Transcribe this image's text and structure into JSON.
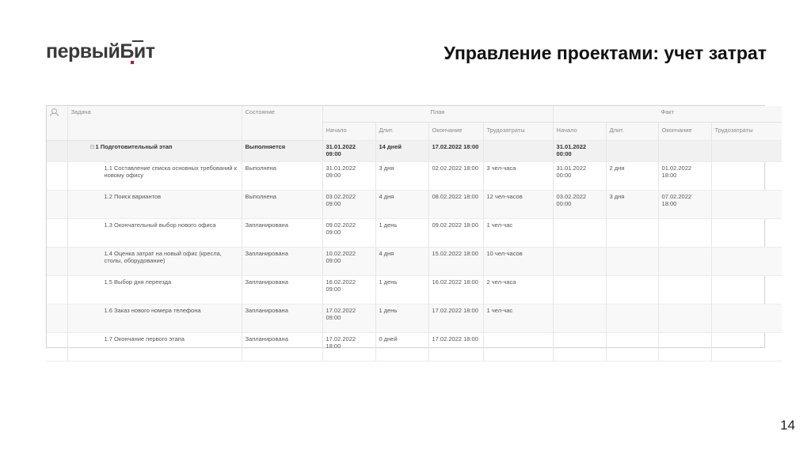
{
  "brand": {
    "logo_text": "первыйБит"
  },
  "slide": {
    "title": "Управление проектами: учет затрат",
    "page_number": "14"
  },
  "table": {
    "headers": {
      "task": "Задача",
      "status": "Состояние",
      "plan": "План",
      "fact": "Факт",
      "start": "Начало",
      "duration": "Длит.",
      "end": "Окончание",
      "effort": "Трудозатраты"
    },
    "group": {
      "task": "1  Подготовительный этап",
      "status": "Выполняется",
      "plan_start": "31.01.2022 09:00",
      "plan_duration": "14 дней",
      "plan_end": "17.02.2022 18:00",
      "plan_effort": "",
      "fact_start": "31.01.2022 00:00",
      "fact_duration": "",
      "fact_end": "",
      "fact_effort": ""
    },
    "rows": [
      {
        "task": "1.1  Составление списка основных требований к новому офису",
        "status": "Выполнена",
        "plan_start": "31.01.2022 09:00",
        "plan_duration": "3 дня",
        "plan_end": "02.02.2022 18:00",
        "plan_effort": "3 чел-часа",
        "fact_start": "31.01.2022 00:00",
        "fact_duration": "2 дня",
        "fact_end": "01.02.2022 18:00",
        "fact_effort": ""
      },
      {
        "task": "1.2  Поиск вариантов",
        "status": "Выполнена",
        "plan_start": "03.02.2022 09:00",
        "plan_duration": "4 дня",
        "plan_end": "08.02.2022 18:00",
        "plan_effort": "12 чел-часов",
        "fact_start": "03.02.2022 00:00",
        "fact_duration": "3 дня",
        "fact_end": "07.02.2022 18:00",
        "fact_effort": ""
      },
      {
        "task": "1.3  Окончательный выбор нового офиса",
        "status": "Запланирована",
        "plan_start": "09.02.2022 09:00",
        "plan_duration": "1 день",
        "plan_end": "09.02.2022 18:00",
        "plan_effort": "1 чел-час",
        "fact_start": "",
        "fact_duration": "",
        "fact_end": "",
        "fact_effort": ""
      },
      {
        "task": "1.4  Оценка затрат на новый офис (кресла, столы, оборудование)",
        "status": "Запланирована",
        "plan_start": "10.02.2022 09:00",
        "plan_duration": "4 дня",
        "plan_end": "15.02.2022 18:00",
        "plan_effort": "10 чел-часов",
        "fact_start": "",
        "fact_duration": "",
        "fact_end": "",
        "fact_effort": ""
      },
      {
        "task": "1.5  Выбор дня переезда",
        "status": "Запланирована",
        "plan_start": "16.02.2022 09:00",
        "plan_duration": "1 день",
        "plan_end": "16.02.2022 18:00",
        "plan_effort": "2 чел-часа",
        "fact_start": "",
        "fact_duration": "",
        "fact_end": "",
        "fact_effort": ""
      },
      {
        "task": "1.6  Заказ нового номера телефона",
        "status": "Запланирована",
        "plan_start": "17.02.2022 09:00",
        "plan_duration": "1 день",
        "plan_end": "17.02.2022 18:00",
        "plan_effort": "1 чел-час",
        "fact_start": "",
        "fact_duration": "",
        "fact_end": "",
        "fact_effort": ""
      },
      {
        "task": "1.7  Окончание первого этапа",
        "status": "Запланирована",
        "plan_start": "17.02.2022 18:00",
        "plan_duration": "0 дней",
        "plan_end": "17.02.2022 18:00",
        "plan_effort": "",
        "fact_start": "",
        "fact_duration": "",
        "fact_end": "",
        "fact_effort": ""
      }
    ]
  },
  "colors": {
    "brand_red": "#c8102e",
    "text": "#111111"
  },
  "icons": {
    "header_user": "user-icon"
  }
}
